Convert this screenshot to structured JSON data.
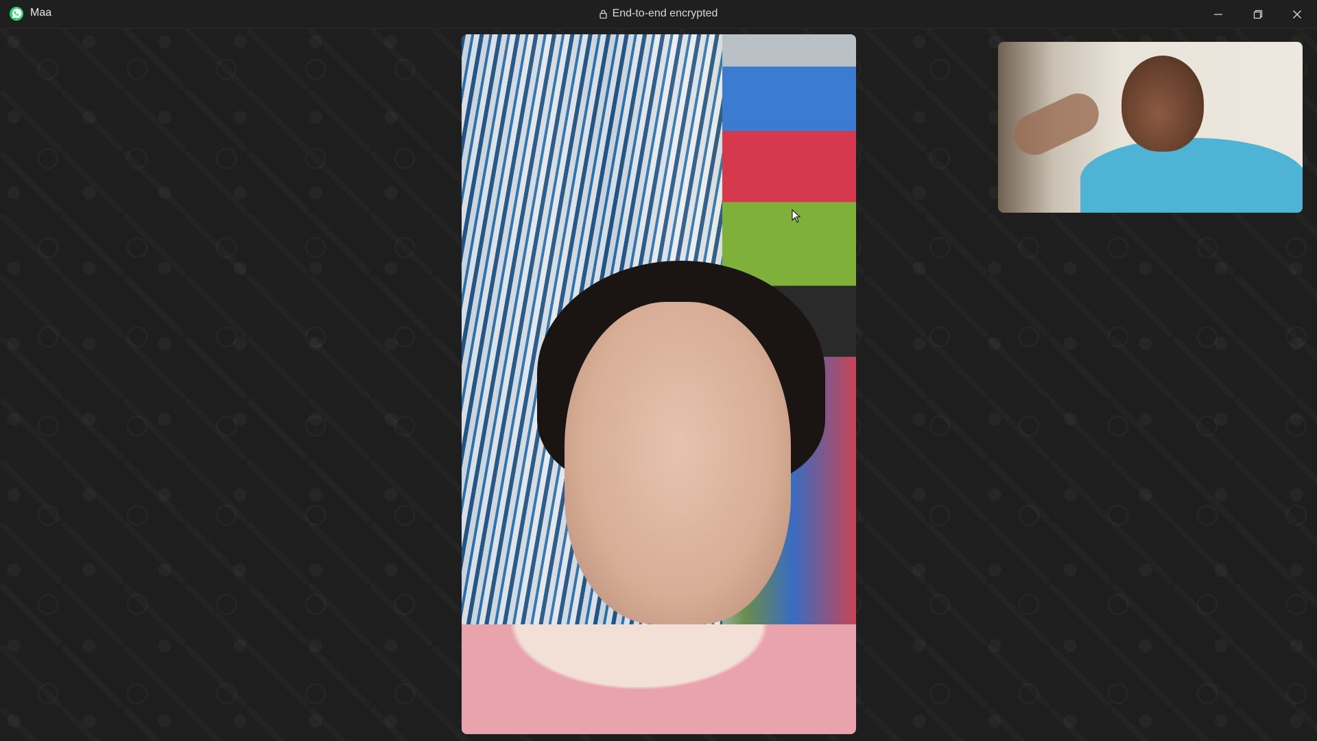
{
  "window": {
    "contact_name": "Maa",
    "encryption_label": "End-to-end encrypted",
    "controls": [
      "minimize",
      "restore",
      "close"
    ]
  },
  "icons": {
    "app_logo": "whatsapp-icon",
    "lock": "lock-icon"
  },
  "colors": {
    "titlebar_bg": "#1f1f1f",
    "wallpaper_bg": "#1e1e1e",
    "brand_green": "#25d366"
  }
}
